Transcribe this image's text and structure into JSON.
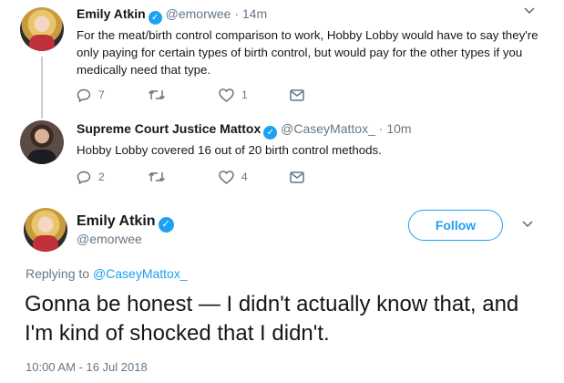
{
  "thread": [
    {
      "name": "Emily Atkin",
      "handle": "@emorwee",
      "separator": "·",
      "time": "14m",
      "text": "For the meat/birth control comparison to work, Hobby Lobby would have to say they're only paying for certain types of birth control, but would pay for the other types if you medically need that type.",
      "replies": "7",
      "retweets": "",
      "likes": "1"
    },
    {
      "name": "Supreme Court Justice Mattox",
      "handle": "@CaseyMattox_",
      "separator": "·",
      "time": "10m",
      "text": "Hobby Lobby covered 16 out of 20 birth control methods.",
      "replies": "2",
      "retweets": "",
      "likes": "4"
    }
  ],
  "main": {
    "name": "Emily Atkin",
    "handle": "@emorwee",
    "follow_label": "Follow",
    "replying_prefix": "Replying to",
    "replying_to": "@CaseyMattox_",
    "text": "Gonna be honest — I didn't actually know that, and I'm kind of shocked that I didn't.",
    "timestamp": "10:00 AM - 16 Jul 2018"
  },
  "icons": {
    "verified": "verified-badge-icon",
    "reply": "reply-icon",
    "retweet": "retweet-icon",
    "like": "heart-icon",
    "dm": "envelope-icon",
    "more": "chevron-down-icon"
  },
  "colors": {
    "accent": "#1da1f2",
    "muted": "#657786",
    "text": "#14171a",
    "thread_line": "#c4cfd6"
  }
}
